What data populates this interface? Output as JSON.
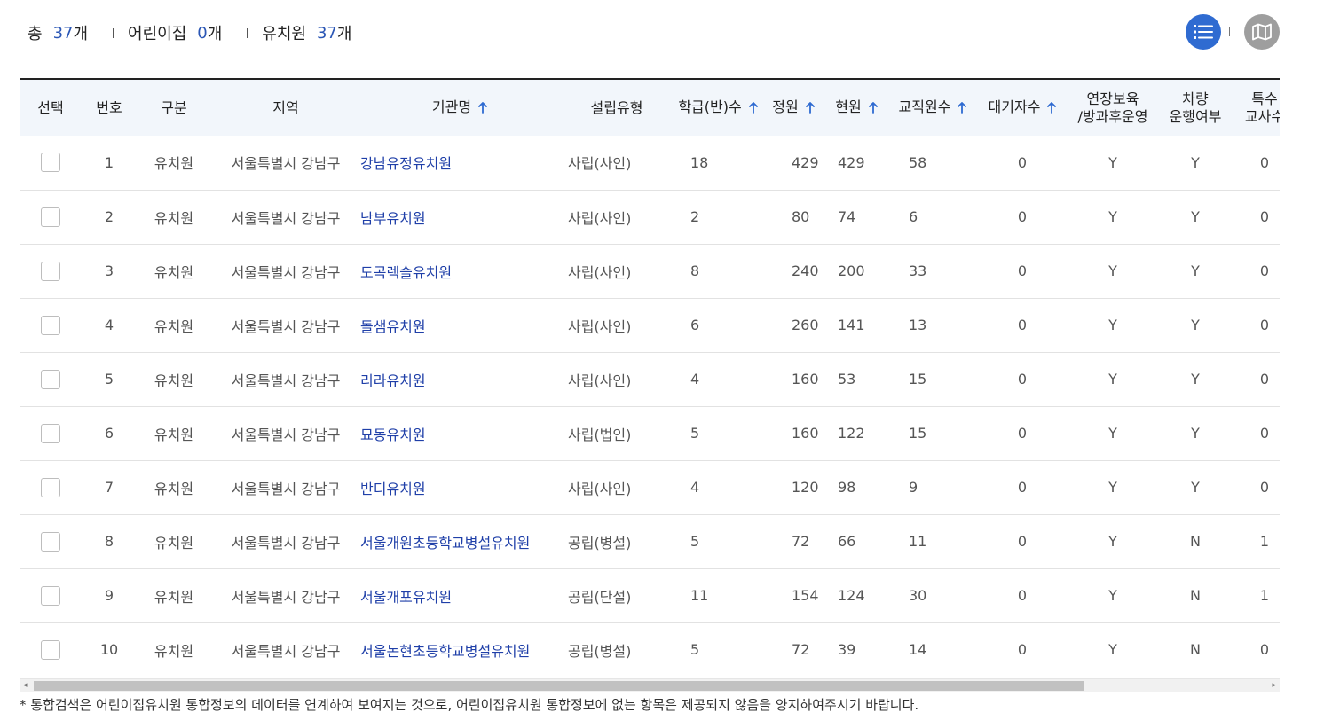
{
  "summary": {
    "total_label": "총",
    "total_count": "37",
    "daycare_label": "어린이집",
    "daycare_count": "0",
    "kindergarten_label": "유치원",
    "kindergarten_count": "37",
    "unit": "개"
  },
  "view_toggle": {
    "active": "list",
    "list_icon": "list-icon",
    "map_icon": "map-icon",
    "active_color": "#2f6bd1",
    "inactive_color": "#9e9e9e"
  },
  "table": {
    "headers": [
      {
        "label": "선택",
        "sortable": false
      },
      {
        "label": "번호",
        "sortable": false
      },
      {
        "label": "구분",
        "sortable": false
      },
      {
        "label": "지역",
        "sortable": false
      },
      {
        "label": "기관명",
        "sortable": true
      },
      {
        "label": "설립유형",
        "sortable": false
      },
      {
        "label": "학급(반)수",
        "sortable": true
      },
      {
        "label": "정원",
        "sortable": true
      },
      {
        "label": "현원",
        "sortable": true
      },
      {
        "label": "교직원수",
        "sortable": true
      },
      {
        "label": "대기자수",
        "sortable": true
      },
      {
        "label": "연장보육\n/방과후운영",
        "sortable": false
      },
      {
        "label": "차량\n운행여부",
        "sortable": false
      },
      {
        "label": "특수\n교사수",
        "sortable": false
      }
    ],
    "rows": [
      {
        "no": "1",
        "type": "유치원",
        "region": "서울특별시 강남구",
        "name": "강남유정유치원",
        "founding": "사립(사인)",
        "classes": "18",
        "capacity": "429",
        "current": "429",
        "staff": "58",
        "waiting": "0",
        "extended": "Y",
        "vehicle": "Y",
        "special": "0"
      },
      {
        "no": "2",
        "type": "유치원",
        "region": "서울특별시 강남구",
        "name": "남부유치원",
        "founding": "사립(사인)",
        "classes": "2",
        "capacity": "80",
        "current": "74",
        "staff": "6",
        "waiting": "0",
        "extended": "Y",
        "vehicle": "Y",
        "special": "0"
      },
      {
        "no": "3",
        "type": "유치원",
        "region": "서울특별시 강남구",
        "name": "도곡렉슬유치원",
        "founding": "사립(사인)",
        "classes": "8",
        "capacity": "240",
        "current": "200",
        "staff": "33",
        "waiting": "0",
        "extended": "Y",
        "vehicle": "Y",
        "special": "0"
      },
      {
        "no": "4",
        "type": "유치원",
        "region": "서울특별시 강남구",
        "name": "돌샘유치원",
        "founding": "사립(사인)",
        "classes": "6",
        "capacity": "260",
        "current": "141",
        "staff": "13",
        "waiting": "0",
        "extended": "Y",
        "vehicle": "Y",
        "special": "0"
      },
      {
        "no": "5",
        "type": "유치원",
        "region": "서울특별시 강남구",
        "name": "리라유치원",
        "founding": "사립(사인)",
        "classes": "4",
        "capacity": "160",
        "current": "53",
        "staff": "15",
        "waiting": "0",
        "extended": "Y",
        "vehicle": "Y",
        "special": "0"
      },
      {
        "no": "6",
        "type": "유치원",
        "region": "서울특별시 강남구",
        "name": "묘동유치원",
        "founding": "사립(법인)",
        "classes": "5",
        "capacity": "160",
        "current": "122",
        "staff": "15",
        "waiting": "0",
        "extended": "Y",
        "vehicle": "Y",
        "special": "0"
      },
      {
        "no": "7",
        "type": "유치원",
        "region": "서울특별시 강남구",
        "name": "반디유치원",
        "founding": "사립(사인)",
        "classes": "4",
        "capacity": "120",
        "current": "98",
        "staff": "9",
        "waiting": "0",
        "extended": "Y",
        "vehicle": "Y",
        "special": "0"
      },
      {
        "no": "8",
        "type": "유치원",
        "region": "서울특별시 강남구",
        "name": "서울개원초등학교병설유치원",
        "founding": "공립(병설)",
        "classes": "5",
        "capacity": "72",
        "current": "66",
        "staff": "11",
        "waiting": "0",
        "extended": "Y",
        "vehicle": "N",
        "special": "1"
      },
      {
        "no": "9",
        "type": "유치원",
        "region": "서울특별시 강남구",
        "name": "서울개포유치원",
        "founding": "공립(단설)",
        "classes": "11",
        "capacity": "154",
        "current": "124",
        "staff": "30",
        "waiting": "0",
        "extended": "Y",
        "vehicle": "N",
        "special": "1"
      },
      {
        "no": "10",
        "type": "유치원",
        "region": "서울특별시 강남구",
        "name": "서울논현초등학교병설유치원",
        "founding": "공립(병설)",
        "classes": "5",
        "capacity": "72",
        "current": "39",
        "staff": "14",
        "waiting": "0",
        "extended": "Y",
        "vehicle": "N",
        "special": "0"
      }
    ]
  },
  "notice": "* 통합검색은 어린이집유치원 통합정보의 데이터를 연계하여 보여지는 것으로, 어린이집유치원 통합정보에 없는 항목은 제공되지 않음을 양지하여주시기 바랍니다."
}
